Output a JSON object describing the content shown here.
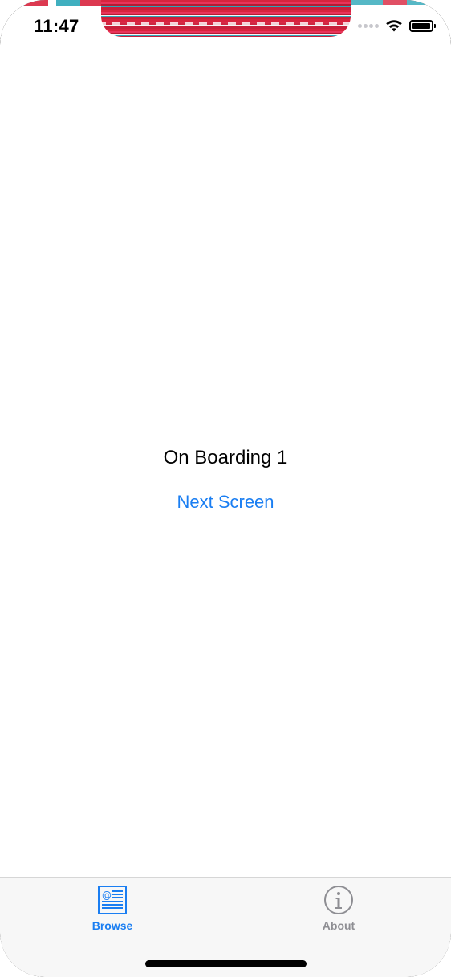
{
  "status_bar": {
    "time": "11:47"
  },
  "main": {
    "title": "On Boarding 1",
    "next_button_label": "Next Screen"
  },
  "tab_bar": {
    "tabs": [
      {
        "label": "Browse",
        "icon": "browse-icon",
        "selected": true
      },
      {
        "label": "About",
        "icon": "info-icon",
        "selected": false
      }
    ]
  },
  "colors": {
    "accent": "#1a7ef2",
    "inactive_tab": "#8e8e93",
    "tab_bar_bg": "#f7f7f7"
  }
}
